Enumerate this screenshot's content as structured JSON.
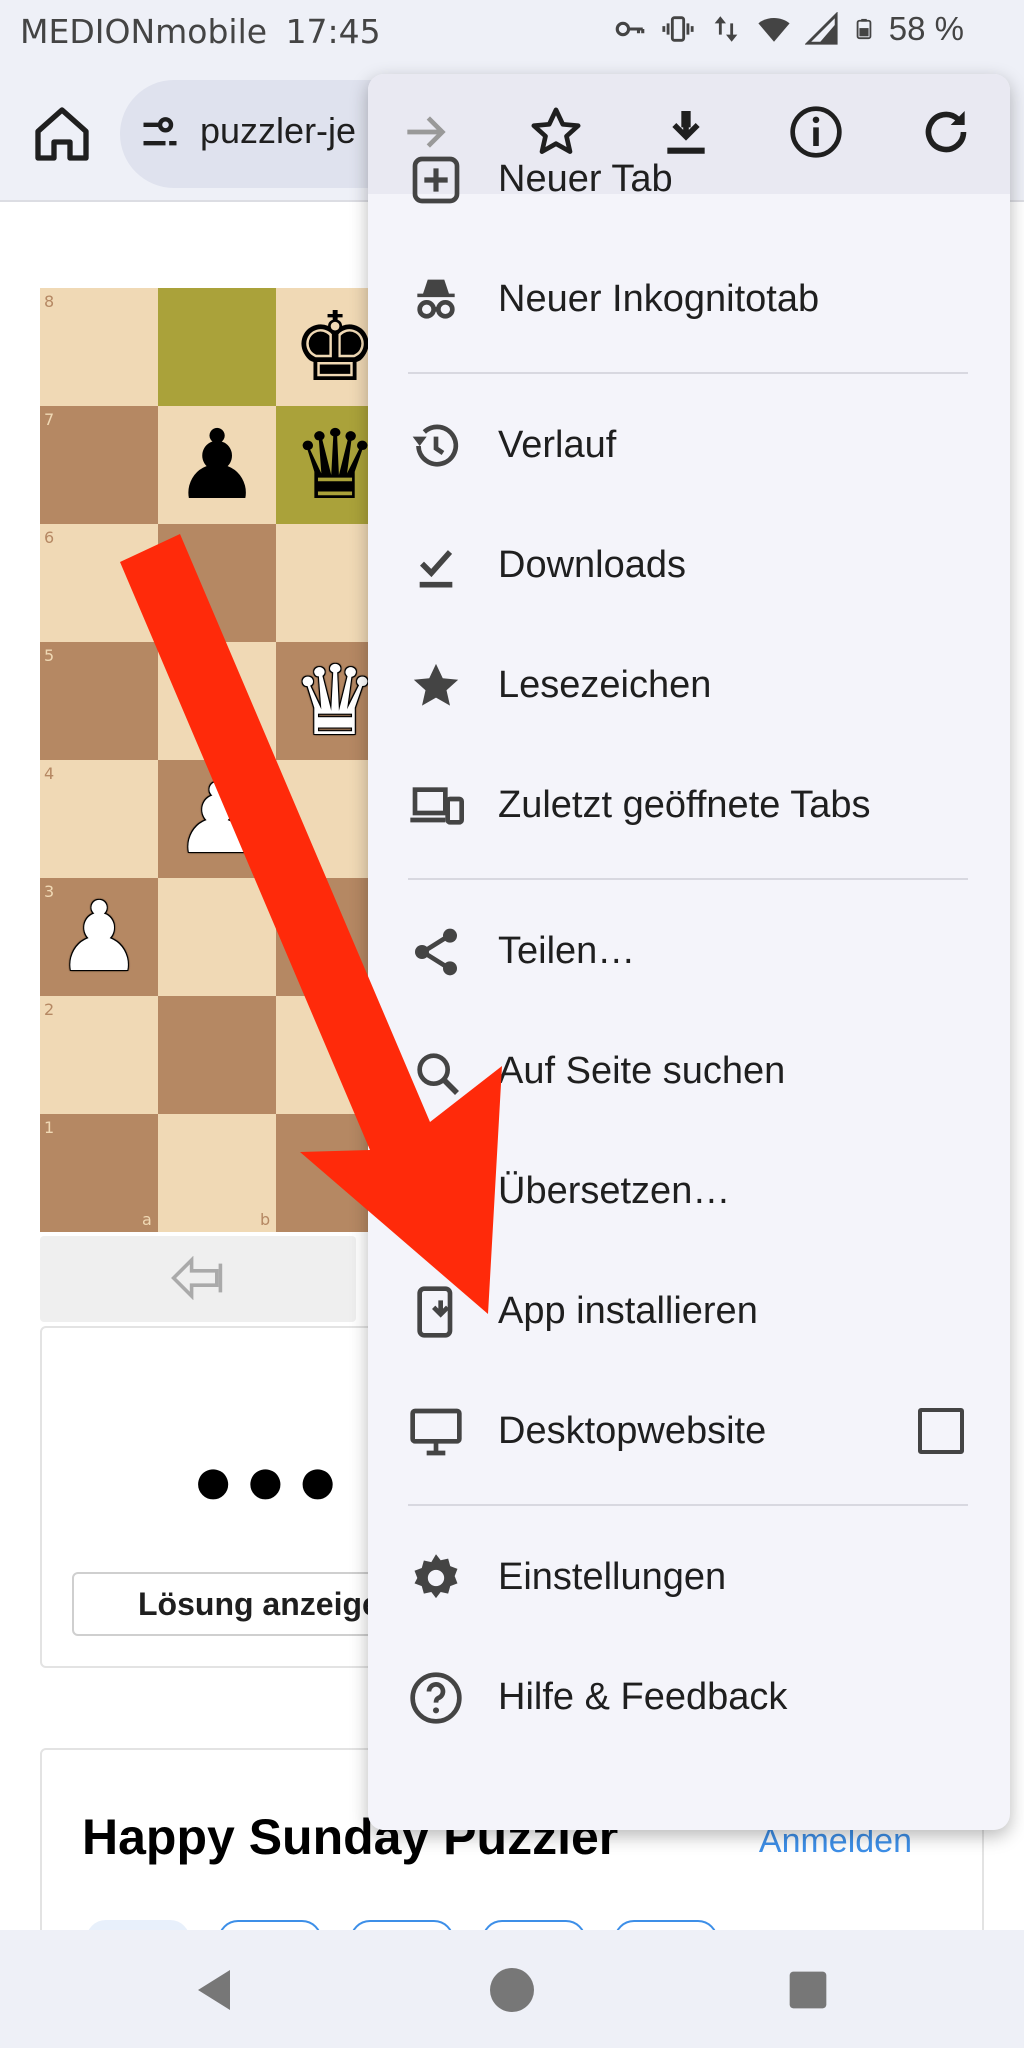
{
  "status_bar": {
    "carrier": "MEDIONmobile",
    "time": "17:45",
    "battery": "58 %",
    "icons": [
      "key-icon",
      "vibrate-icon",
      "data-arrows-icon",
      "wifi-icon",
      "signal-icon",
      "battery-icon"
    ]
  },
  "toolbar": {
    "url": "puzzler-je",
    "home_icon": "home-icon",
    "site_settings_icon": "tune-icon"
  },
  "chess": {
    "rank_labels": [
      "8",
      "7",
      "6",
      "5",
      "4",
      "3",
      "2",
      "1"
    ],
    "file_labels": [
      "a",
      "b"
    ],
    "pieces": [
      {
        "glyph": "♚",
        "color": "black",
        "square": "c8"
      },
      {
        "glyph": "♟",
        "color": "black",
        "square": "b7"
      },
      {
        "glyph": "♛",
        "color": "black",
        "square": "c7"
      },
      {
        "glyph": "♛",
        "color": "white",
        "square": "c5"
      },
      {
        "glyph": "♟",
        "color": "white",
        "square": "b4"
      },
      {
        "glyph": "♟",
        "color": "white",
        "square": "a3"
      }
    ],
    "highlighted_squares": [
      "b8",
      "c7"
    ]
  },
  "puzzle_card": {
    "dots": "●●●",
    "solution_button": "Lösung anzeige"
  },
  "puzzle_list": {
    "title": "Happy Sunday Puzzler",
    "login_link": "Anmelden"
  },
  "menu": {
    "toolbar_icons": [
      "forward-icon",
      "bookmark-star-icon",
      "download-icon",
      "info-icon",
      "reload-icon"
    ],
    "items": [
      {
        "label": "Neuer Tab",
        "icon": "new-tab-icon"
      },
      {
        "label": "Neuer Inkognitotab",
        "icon": "incognito-icon"
      },
      {
        "label": "Verlauf",
        "icon": "history-icon"
      },
      {
        "label": "Downloads",
        "icon": "downloads-icon"
      },
      {
        "label": "Lesezeichen",
        "icon": "bookmarks-icon"
      },
      {
        "label": "Zuletzt geöffnete Tabs",
        "icon": "recent-tabs-icon"
      },
      {
        "label": "Teilen…",
        "icon": "share-icon"
      },
      {
        "label": "Auf Seite suchen",
        "icon": "find-in-page-icon"
      },
      {
        "label": "Übersetzen…",
        "icon": "translate-icon"
      },
      {
        "label": "App installieren",
        "icon": "install-app-icon"
      },
      {
        "label": "Desktopwebsite",
        "icon": "desktop-icon",
        "checkbox_checked": false
      },
      {
        "label": "Einstellungen",
        "icon": "settings-gear-icon"
      },
      {
        "label": "Hilfe & Feedback",
        "icon": "help-icon"
      }
    ]
  },
  "colors": {
    "arrow": "#ff2a0a",
    "link": "#3d8fe8",
    "light_square": "#f0d9b5",
    "dark_square": "#b58863",
    "highlight_square": "#aaa23a"
  }
}
